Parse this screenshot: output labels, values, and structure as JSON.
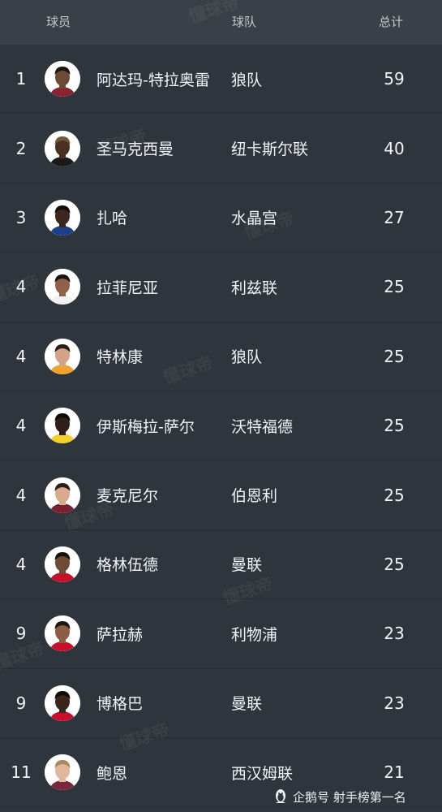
{
  "header": {
    "player_label": "球员",
    "team_label": "球队",
    "total_label": "总计"
  },
  "players": [
    {
      "rank": "1",
      "name": "阿达玛-特拉奥雷",
      "team": "狼队",
      "goals": "59",
      "skin": "#6b4a36",
      "hair": "#1d1512",
      "kit": "#8a2230"
    },
    {
      "rank": "2",
      "name": "圣马克西曼",
      "team": "纽卡斯尔联",
      "goals": "40",
      "skin": "#4a3024",
      "hair": "#6f5a3a",
      "kit": "#1a1a1a"
    },
    {
      "rank": "3",
      "name": "扎哈",
      "team": "水晶宫",
      "goals": "27",
      "skin": "#3d271d",
      "hair": "#120d0b",
      "kit": "#1b3f8a"
    },
    {
      "rank": "4",
      "name": "拉菲尼亚",
      "team": "利兹联",
      "goals": "25",
      "skin": "#8d6248",
      "hair": "#1a1410",
      "kit": "#f2f2f2"
    },
    {
      "rank": "4",
      "name": "特林康",
      "team": "狼队",
      "goals": "25",
      "skin": "#d1a488",
      "hair": "#2a1d16",
      "kit": "#f0a22e"
    },
    {
      "rank": "4",
      "name": "伊斯梅拉-萨尔",
      "team": "沃特福德",
      "goals": "25",
      "skin": "#2f1f18",
      "hair": "#0d0a09",
      "kit": "#f1d02c"
    },
    {
      "rank": "4",
      "name": "麦克尼尔",
      "team": "伯恩利",
      "goals": "25",
      "skin": "#d8ab8e",
      "hair": "#2b1f17",
      "kit": "#7b2030"
    },
    {
      "rank": "4",
      "name": "格林伍德",
      "team": "曼联",
      "goals": "25",
      "skin": "#6e4a37",
      "hair": "#17110e",
      "kit": "#c8102e"
    },
    {
      "rank": "9",
      "name": "萨拉赫",
      "team": "利物浦",
      "goals": "23",
      "skin": "#8a5e44",
      "hair": "#1f1612",
      "kit": "#c8102e"
    },
    {
      "rank": "9",
      "name": "博格巴",
      "team": "曼联",
      "goals": "23",
      "skin": "#3a261d",
      "hair": "#0e0b0a",
      "kit": "#c8102e"
    },
    {
      "rank": "11",
      "name": "鲍恩",
      "team": "西汉姆联",
      "goals": "21",
      "skin": "#e1b79b",
      "hair": "#a98a60",
      "kit": "#7a263a"
    }
  ],
  "watermark": "懂球帝",
  "footer": {
    "text": "企鹅号 射手榜第一名",
    "icon": "penguin-icon"
  }
}
